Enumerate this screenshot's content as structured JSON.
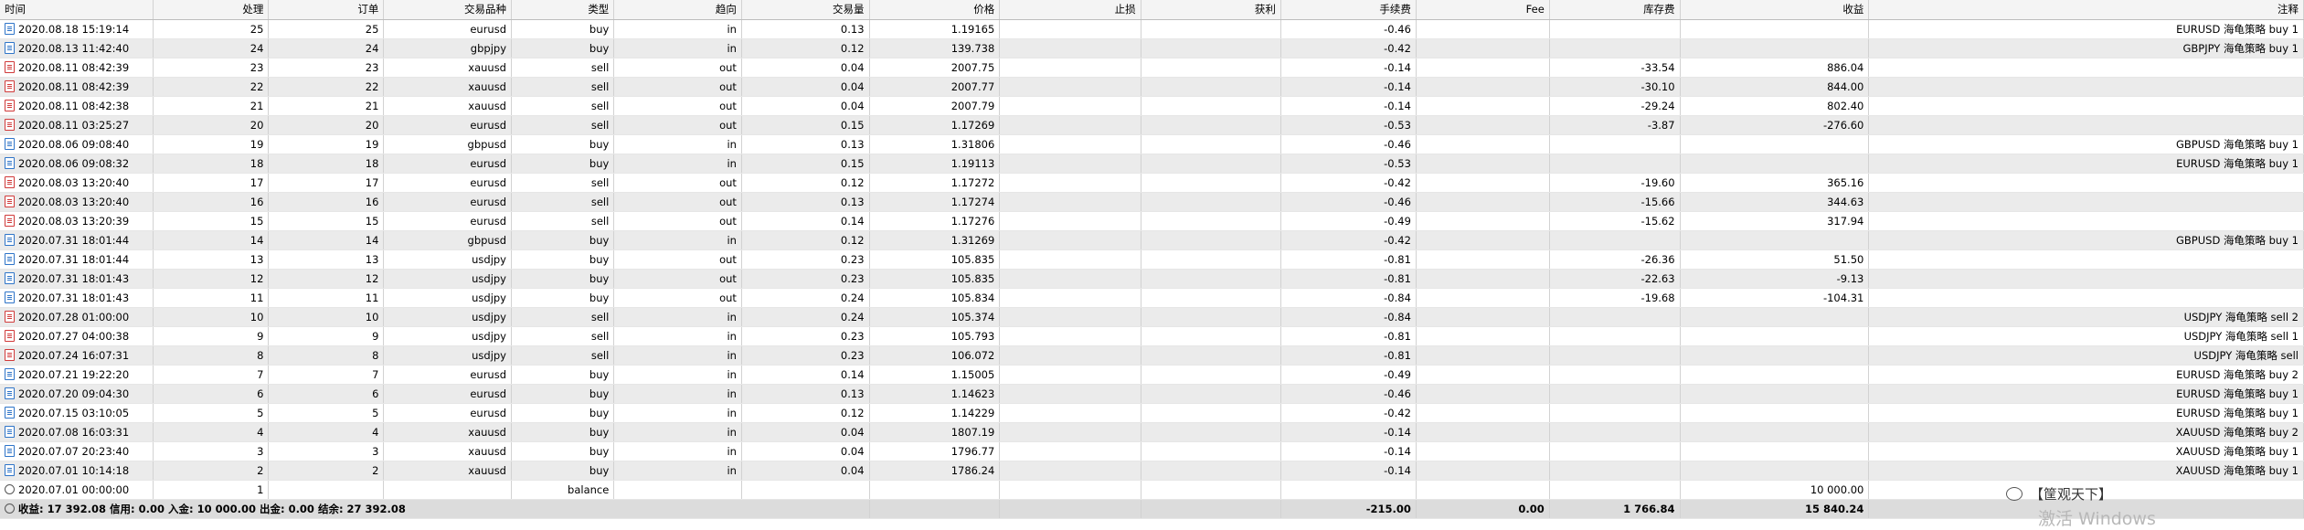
{
  "headers": {
    "time": "时间",
    "deal": "处理",
    "order": "订单",
    "symbol": "交易品种",
    "type": "类型",
    "direction": "趋向",
    "volume": "交易量",
    "price": "价格",
    "sl": "止损",
    "tp": "获利",
    "commission": "手续费",
    "fee": "Fee",
    "swap": "库存费",
    "profit": "收益",
    "comment": "注释"
  },
  "rows": [
    {
      "icon": "buy",
      "time": "2020.08.18 15:19:14",
      "deal": "25",
      "order": "25",
      "symbol": "eurusd",
      "type": "buy",
      "direction": "in",
      "volume": "0.13",
      "price": "1.19165",
      "sl": "",
      "tp": "",
      "commission": "-0.46",
      "fee": "",
      "swap": "",
      "profit": "",
      "comment": "EURUSD 海龟策略 buy 1"
    },
    {
      "icon": "buy",
      "time": "2020.08.13 11:42:40",
      "deal": "24",
      "order": "24",
      "symbol": "gbpjpy",
      "type": "buy",
      "direction": "in",
      "volume": "0.12",
      "price": "139.738",
      "sl": "",
      "tp": "",
      "commission": "-0.42",
      "fee": "",
      "swap": "",
      "profit": "",
      "comment": "GBPJPY 海龟策略 buy 1"
    },
    {
      "icon": "sell",
      "time": "2020.08.11 08:42:39",
      "deal": "23",
      "order": "23",
      "symbol": "xauusd",
      "type": "sell",
      "direction": "out",
      "volume": "0.04",
      "price": "2007.75",
      "sl": "",
      "tp": "",
      "commission": "-0.14",
      "fee": "",
      "swap": "-33.54",
      "profit": "886.04",
      "comment": ""
    },
    {
      "icon": "sell",
      "time": "2020.08.11 08:42:39",
      "deal": "22",
      "order": "22",
      "symbol": "xauusd",
      "type": "sell",
      "direction": "out",
      "volume": "0.04",
      "price": "2007.77",
      "sl": "",
      "tp": "",
      "commission": "-0.14",
      "fee": "",
      "swap": "-30.10",
      "profit": "844.00",
      "comment": ""
    },
    {
      "icon": "sell",
      "time": "2020.08.11 08:42:38",
      "deal": "21",
      "order": "21",
      "symbol": "xauusd",
      "type": "sell",
      "direction": "out",
      "volume": "0.04",
      "price": "2007.79",
      "sl": "",
      "tp": "",
      "commission": "-0.14",
      "fee": "",
      "swap": "-29.24",
      "profit": "802.40",
      "comment": ""
    },
    {
      "icon": "sell",
      "time": "2020.08.11 03:25:27",
      "deal": "20",
      "order": "20",
      "symbol": "eurusd",
      "type": "sell",
      "direction": "out",
      "volume": "0.15",
      "price": "1.17269",
      "sl": "",
      "tp": "",
      "commission": "-0.53",
      "fee": "",
      "swap": "-3.87",
      "profit": "-276.60",
      "comment": ""
    },
    {
      "icon": "buy",
      "time": "2020.08.06 09:08:40",
      "deal": "19",
      "order": "19",
      "symbol": "gbpusd",
      "type": "buy",
      "direction": "in",
      "volume": "0.13",
      "price": "1.31806",
      "sl": "",
      "tp": "",
      "commission": "-0.46",
      "fee": "",
      "swap": "",
      "profit": "",
      "comment": "GBPUSD 海龟策略 buy 1"
    },
    {
      "icon": "buy",
      "time": "2020.08.06 09:08:32",
      "deal": "18",
      "order": "18",
      "symbol": "eurusd",
      "type": "buy",
      "direction": "in",
      "volume": "0.15",
      "price": "1.19113",
      "sl": "",
      "tp": "",
      "commission": "-0.53",
      "fee": "",
      "swap": "",
      "profit": "",
      "comment": "EURUSD 海龟策略 buy 1"
    },
    {
      "icon": "sell",
      "time": "2020.08.03 13:20:40",
      "deal": "17",
      "order": "17",
      "symbol": "eurusd",
      "type": "sell",
      "direction": "out",
      "volume": "0.12",
      "price": "1.17272",
      "sl": "",
      "tp": "",
      "commission": "-0.42",
      "fee": "",
      "swap": "-19.60",
      "profit": "365.16",
      "comment": ""
    },
    {
      "icon": "sell",
      "time": "2020.08.03 13:20:40",
      "deal": "16",
      "order": "16",
      "symbol": "eurusd",
      "type": "sell",
      "direction": "out",
      "volume": "0.13",
      "price": "1.17274",
      "sl": "",
      "tp": "",
      "commission": "-0.46",
      "fee": "",
      "swap": "-15.66",
      "profit": "344.63",
      "comment": ""
    },
    {
      "icon": "sell",
      "time": "2020.08.03 13:20:39",
      "deal": "15",
      "order": "15",
      "symbol": "eurusd",
      "type": "sell",
      "direction": "out",
      "volume": "0.14",
      "price": "1.17276",
      "sl": "",
      "tp": "",
      "commission": "-0.49",
      "fee": "",
      "swap": "-15.62",
      "profit": "317.94",
      "comment": ""
    },
    {
      "icon": "buy",
      "time": "2020.07.31 18:01:44",
      "deal": "14",
      "order": "14",
      "symbol": "gbpusd",
      "type": "buy",
      "direction": "in",
      "volume": "0.12",
      "price": "1.31269",
      "sl": "",
      "tp": "",
      "commission": "-0.42",
      "fee": "",
      "swap": "",
      "profit": "",
      "comment": "GBPUSD 海龟策略 buy 1"
    },
    {
      "icon": "buy",
      "time": "2020.07.31 18:01:44",
      "deal": "13",
      "order": "13",
      "symbol": "usdjpy",
      "type": "buy",
      "direction": "out",
      "volume": "0.23",
      "price": "105.835",
      "sl": "",
      "tp": "",
      "commission": "-0.81",
      "fee": "",
      "swap": "-26.36",
      "profit": "51.50",
      "comment": ""
    },
    {
      "icon": "buy",
      "time": "2020.07.31 18:01:43",
      "deal": "12",
      "order": "12",
      "symbol": "usdjpy",
      "type": "buy",
      "direction": "out",
      "volume": "0.23",
      "price": "105.835",
      "sl": "",
      "tp": "",
      "commission": "-0.81",
      "fee": "",
      "swap": "-22.63",
      "profit": "-9.13",
      "comment": ""
    },
    {
      "icon": "buy",
      "time": "2020.07.31 18:01:43",
      "deal": "11",
      "order": "11",
      "symbol": "usdjpy",
      "type": "buy",
      "direction": "out",
      "volume": "0.24",
      "price": "105.834",
      "sl": "",
      "tp": "",
      "commission": "-0.84",
      "fee": "",
      "swap": "-19.68",
      "profit": "-104.31",
      "comment": ""
    },
    {
      "icon": "sell",
      "time": "2020.07.28 01:00:00",
      "deal": "10",
      "order": "10",
      "symbol": "usdjpy",
      "type": "sell",
      "direction": "in",
      "volume": "0.24",
      "price": "105.374",
      "sl": "",
      "tp": "",
      "commission": "-0.84",
      "fee": "",
      "swap": "",
      "profit": "",
      "comment": "USDJPY 海龟策略 sell 2"
    },
    {
      "icon": "sell",
      "time": "2020.07.27 04:00:38",
      "deal": "9",
      "order": "9",
      "symbol": "usdjpy",
      "type": "sell",
      "direction": "in",
      "volume": "0.23",
      "price": "105.793",
      "sl": "",
      "tp": "",
      "commission": "-0.81",
      "fee": "",
      "swap": "",
      "profit": "",
      "comment": "USDJPY 海龟策略 sell 1"
    },
    {
      "icon": "sell",
      "time": "2020.07.24 16:07:31",
      "deal": "8",
      "order": "8",
      "symbol": "usdjpy",
      "type": "sell",
      "direction": "in",
      "volume": "0.23",
      "price": "106.072",
      "sl": "",
      "tp": "",
      "commission": "-0.81",
      "fee": "",
      "swap": "",
      "profit": "",
      "comment": "USDJPY 海龟策略 sell"
    },
    {
      "icon": "buy",
      "time": "2020.07.21 19:22:20",
      "deal": "7",
      "order": "7",
      "symbol": "eurusd",
      "type": "buy",
      "direction": "in",
      "volume": "0.14",
      "price": "1.15005",
      "sl": "",
      "tp": "",
      "commission": "-0.49",
      "fee": "",
      "swap": "",
      "profit": "",
      "comment": "EURUSD 海龟策略 buy 2"
    },
    {
      "icon": "buy",
      "time": "2020.07.20 09:04:30",
      "deal": "6",
      "order": "6",
      "symbol": "eurusd",
      "type": "buy",
      "direction": "in",
      "volume": "0.13",
      "price": "1.14623",
      "sl": "",
      "tp": "",
      "commission": "-0.46",
      "fee": "",
      "swap": "",
      "profit": "",
      "comment": "EURUSD 海龟策略 buy 1"
    },
    {
      "icon": "buy",
      "time": "2020.07.15 03:10:05",
      "deal": "5",
      "order": "5",
      "symbol": "eurusd",
      "type": "buy",
      "direction": "in",
      "volume": "0.12",
      "price": "1.14229",
      "sl": "",
      "tp": "",
      "commission": "-0.42",
      "fee": "",
      "swap": "",
      "profit": "",
      "comment": "EURUSD 海龟策略 buy 1"
    },
    {
      "icon": "buy",
      "time": "2020.07.08 16:03:31",
      "deal": "4",
      "order": "4",
      "symbol": "xauusd",
      "type": "buy",
      "direction": "in",
      "volume": "0.04",
      "price": "1807.19",
      "sl": "",
      "tp": "",
      "commission": "-0.14",
      "fee": "",
      "swap": "",
      "profit": "",
      "comment": "XAUUSD 海龟策略 buy 2"
    },
    {
      "icon": "buy",
      "time": "2020.07.07 20:23:40",
      "deal": "3",
      "order": "3",
      "symbol": "xauusd",
      "type": "buy",
      "direction": "in",
      "volume": "0.04",
      "price": "1796.77",
      "sl": "",
      "tp": "",
      "commission": "-0.14",
      "fee": "",
      "swap": "",
      "profit": "",
      "comment": "XAUUSD 海龟策略 buy 1"
    },
    {
      "icon": "buy",
      "time": "2020.07.01 10:14:18",
      "deal": "2",
      "order": "2",
      "symbol": "xauusd",
      "type": "buy",
      "direction": "in",
      "volume": "0.04",
      "price": "1786.24",
      "sl": "",
      "tp": "",
      "commission": "-0.14",
      "fee": "",
      "swap": "",
      "profit": "",
      "comment": "XAUUSD 海龟策略 buy 1"
    },
    {
      "icon": "balance",
      "time": "2020.07.01 00:00:00",
      "deal": "1",
      "order": "",
      "symbol": "",
      "type": "balance",
      "direction": "",
      "volume": "",
      "price": "",
      "sl": "",
      "tp": "",
      "commission": "",
      "fee": "",
      "swap": "",
      "profit": "10 000.00",
      "comment": ""
    }
  ],
  "summary": {
    "text": "收益: 17 392.08  信用: 0.00  入金: 10 000.00  出金: 0.00  结余: 27 392.08",
    "commission": "-215.00",
    "fee": "0.00",
    "swap": "1 766.84",
    "profit": "15 840.24"
  },
  "overlay": {
    "wechat_text": "【筐观天下】",
    "watermark_text": "激活 Windows"
  },
  "colors": {
    "buy_icon": "#2e74c8",
    "sell_icon": "#d03a3a",
    "stripe": "#ebebeb",
    "summary_bg": "#dcdcdc"
  }
}
